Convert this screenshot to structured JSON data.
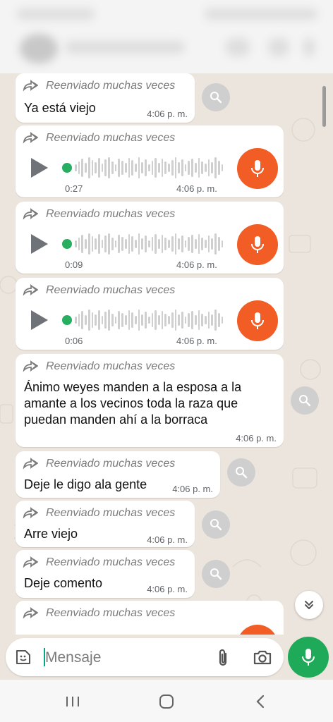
{
  "messages": [
    {
      "type": "text",
      "forwarded": "Reenviado muchas veces",
      "text": "Ya está viejo",
      "time": "4:06 p. m."
    },
    {
      "type": "audio",
      "forwarded": "Reenviado muchas veces",
      "duration": "0:27",
      "time": "4:06 p. m."
    },
    {
      "type": "audio",
      "forwarded": "Reenviado muchas veces",
      "duration": "0:09",
      "time": "4:06 p. m."
    },
    {
      "type": "audio",
      "forwarded": "Reenviado muchas veces",
      "duration": "0:06",
      "time": "4:06 p. m."
    },
    {
      "type": "text",
      "forwarded": "Reenviado muchas veces",
      "text": "Ánimo weyes manden a la esposa a la amante a los vecinos toda la raza que puedan manden ahí a la borraca",
      "time": "4:06 p. m."
    },
    {
      "type": "text",
      "forwarded": "Reenviado muchas veces",
      "text": "Deje le digo ala gente",
      "time": "4:06 p. m."
    },
    {
      "type": "text",
      "forwarded": "Reenviado muchas veces",
      "text": "Arre viejo",
      "time": "4:06 p. m."
    },
    {
      "type": "text",
      "forwarded": "Reenviado muchas veces",
      "text": "Deje comento",
      "time": "4:06 p. m."
    },
    {
      "type": "partial",
      "forwarded": "Reenviado muchas veces"
    }
  ],
  "composer": {
    "placeholder": "Mensaje"
  },
  "icons": {
    "forward": "forward-arrows-icon",
    "search": "search-icon",
    "mic": "mic-icon",
    "sticker": "sticker-icon",
    "attach": "paperclip-icon",
    "camera": "camera-icon",
    "down": "double-chevron-down-icon"
  },
  "colors": {
    "accent_green": "#1faa59",
    "audio_orange": "#f25c25",
    "bubble": "#ffffff"
  }
}
